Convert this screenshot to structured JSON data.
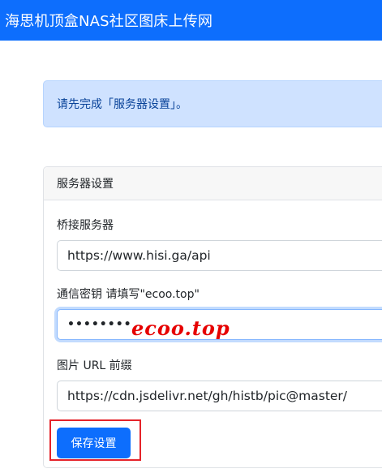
{
  "navbar": {
    "brand": "海思机顶盒NAS社区图床上传网"
  },
  "alert": {
    "message": "请先完成「服务器设置」。"
  },
  "settings_card": {
    "header": "服务器设置",
    "bridge_server": {
      "label": "桥接服务器",
      "value": "https://www.hisi.ga/api"
    },
    "secret_key": {
      "label": "通信密钥 请填写\"ecoo.top\"",
      "masked_value": "••••••••",
      "watermark": "ecoo.top"
    },
    "image_url_prefix": {
      "label": "图片 URL 前缀",
      "value": "https://cdn.jsdelivr.net/gh/histb/pic@master/"
    },
    "save_label": "保存设置"
  },
  "colors": {
    "primary": "#0d6efd",
    "alert_bg": "#cfe2ff",
    "alert_text": "#084298",
    "annotation_red": "#e5232a"
  }
}
